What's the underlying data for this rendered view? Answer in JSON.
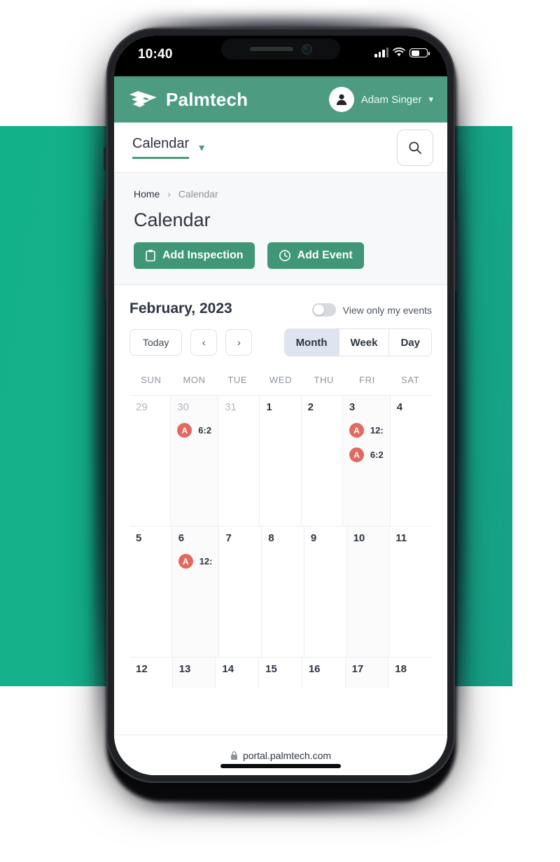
{
  "theme": {
    "header_green": "#4d9c82",
    "band_green": "#15b18c",
    "button_green": "#3f9778",
    "event_avatar_red": "#e2695f",
    "segment_active_blue": "#dee5f0"
  },
  "status_bar": {
    "time": "10:40",
    "signal_icon": "signal-bars-icon",
    "wifi_icon": "wifi-icon",
    "battery_icon": "battery-icon"
  },
  "app_header": {
    "logo_icon": "palmtech-logo-icon",
    "brand": "Palmtech",
    "avatar_icon": "user-avatar-icon",
    "user_name": "Adam Singer",
    "user_chevron_icon": "chevron-down-icon"
  },
  "module_nav": {
    "label": "Calendar",
    "chevron_icon": "chevron-down-icon",
    "search_icon": "search-icon"
  },
  "breadcrumb": {
    "home": "Home",
    "separator": "›",
    "current": "Calendar"
  },
  "page": {
    "title": "Calendar",
    "actions": [
      {
        "label": "Add Inspection",
        "icon": "clipboard-icon"
      },
      {
        "label": "Add Event",
        "icon": "clock-icon"
      }
    ]
  },
  "calendar": {
    "month_label": "February, 2023",
    "only_my_events": {
      "label": "View only my events",
      "enabled": false
    },
    "today_label": "Today",
    "prev_icon": "chevron-left-icon",
    "next_icon": "chevron-right-icon",
    "views": [
      {
        "label": "Month",
        "active": true
      },
      {
        "label": "Week",
        "active": false
      },
      {
        "label": "Day",
        "active": false
      }
    ],
    "day_headers": [
      "SUN",
      "MON",
      "TUE",
      "WED",
      "THU",
      "FRI",
      "SAT"
    ],
    "weeks": [
      {
        "days": [
          {
            "num": "29",
            "muted": true,
            "events": []
          },
          {
            "num": "30",
            "muted": true,
            "events": [
              {
                "avatar": "A",
                "time": "6:2"
              }
            ]
          },
          {
            "num": "31",
            "muted": true,
            "events": []
          },
          {
            "num": "1",
            "muted": false,
            "events": []
          },
          {
            "num": "2",
            "muted": false,
            "events": []
          },
          {
            "num": "3",
            "muted": false,
            "events": [
              {
                "avatar": "A",
                "time": "12:"
              },
              {
                "avatar": "A",
                "time": "6:2"
              }
            ]
          },
          {
            "num": "4",
            "muted": false,
            "events": []
          }
        ]
      },
      {
        "days": [
          {
            "num": "5",
            "muted": false,
            "events": []
          },
          {
            "num": "6",
            "muted": false,
            "events": [
              {
                "avatar": "A",
                "time": "12:"
              }
            ]
          },
          {
            "num": "7",
            "muted": false,
            "events": []
          },
          {
            "num": "8",
            "muted": false,
            "events": []
          },
          {
            "num": "9",
            "muted": false,
            "events": []
          },
          {
            "num": "10",
            "muted": false,
            "events": []
          },
          {
            "num": "11",
            "muted": false,
            "events": []
          }
        ]
      },
      {
        "days": [
          {
            "num": "12",
            "muted": false,
            "events": []
          },
          {
            "num": "13",
            "muted": false,
            "events": []
          },
          {
            "num": "14",
            "muted": false,
            "events": []
          },
          {
            "num": "15",
            "muted": false,
            "events": []
          },
          {
            "num": "16",
            "muted": false,
            "events": []
          },
          {
            "num": "17",
            "muted": false,
            "events": []
          },
          {
            "num": "18",
            "muted": false,
            "events": []
          }
        ]
      }
    ]
  },
  "browser": {
    "lock_icon": "lock-icon",
    "url": "portal.palmtech.com"
  }
}
